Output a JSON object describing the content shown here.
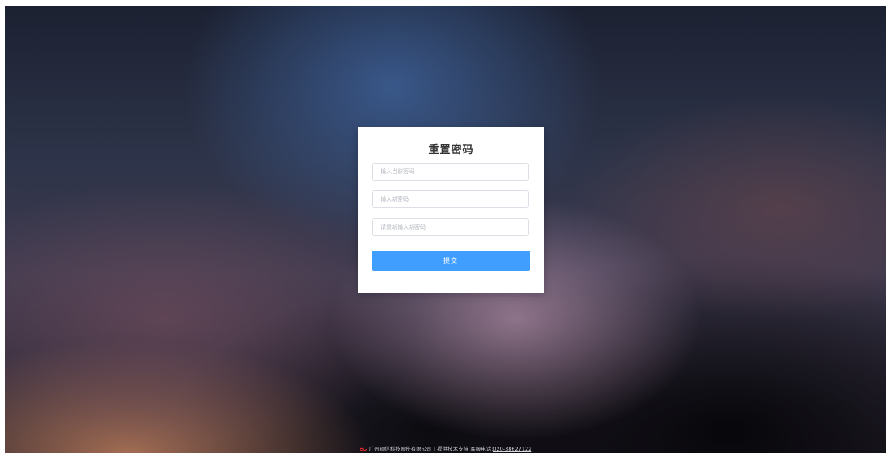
{
  "form": {
    "title": "重置密码",
    "current_password_placeholder": "输入当前密码",
    "new_password_placeholder": "输入新密码",
    "confirm_password_placeholder": "请重新输入新密码",
    "submit_label": "提交"
  },
  "footer": {
    "logo_icon": "company-logo-icon",
    "company": "广州硕信科技股份有限公司",
    "separator": "|",
    "support": "提供技术支持",
    "hotline_label": "客服电话:",
    "phone": "020-38627122"
  },
  "colors": {
    "primary_button": "#409eff",
    "logo": "#e02a2a"
  }
}
